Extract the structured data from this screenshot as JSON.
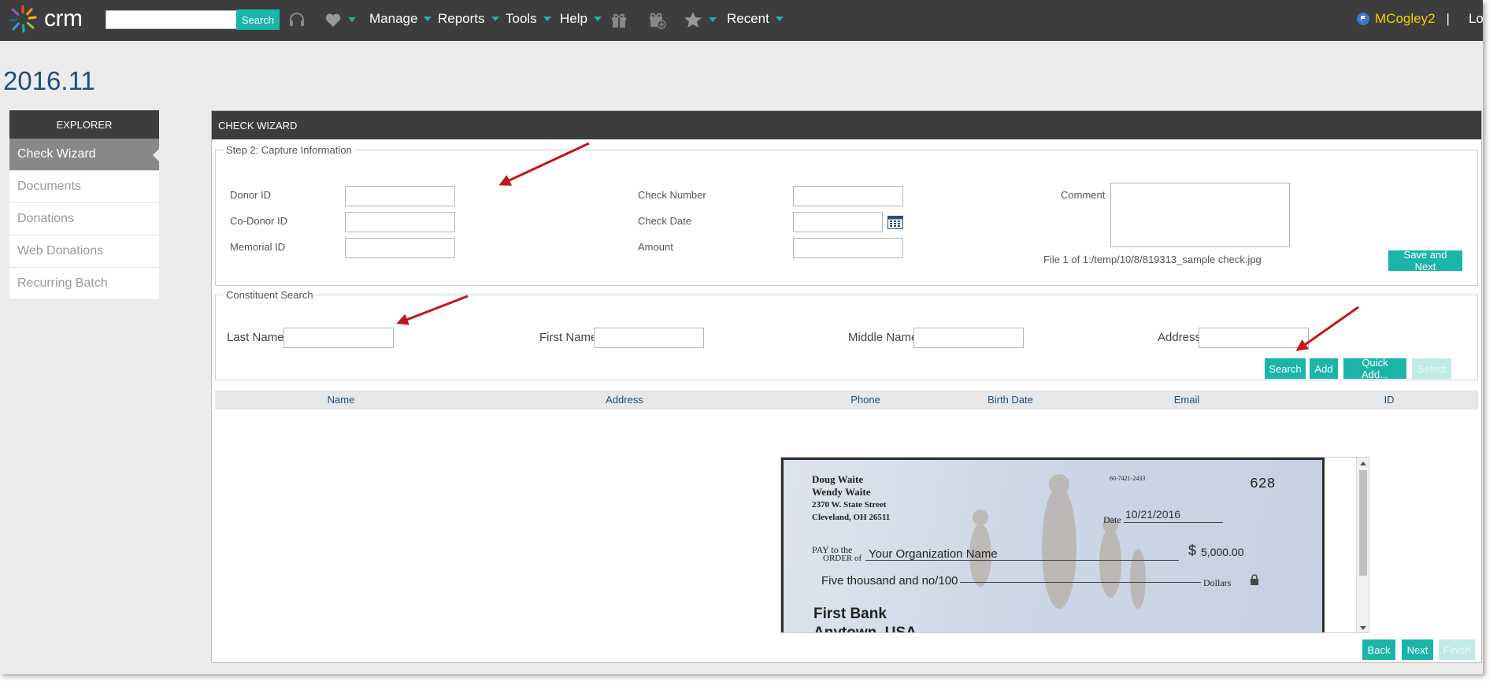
{
  "app": {
    "logo_text": "crm"
  },
  "topnav": {
    "search_placeholder": "",
    "search_button": "Search",
    "items": [
      "Manage",
      "Reports",
      "Tools",
      "Help",
      "Recent"
    ],
    "user_name": "MCogley2",
    "separator": "|",
    "logout_label": "Log"
  },
  "page": {
    "title": "2016.11"
  },
  "sidebar": {
    "header": "EXPLORER",
    "items": [
      {
        "label": "Check Wizard",
        "active": true
      },
      {
        "label": "Documents"
      },
      {
        "label": "Donations"
      },
      {
        "label": "Web Donations"
      },
      {
        "label": "Recurring Batch"
      }
    ]
  },
  "wizard": {
    "header": "CHECK WIZARD",
    "capture": {
      "legend": "Step 2: Capture Information",
      "donor_id_label": "Donor ID",
      "codonor_id_label": "Co-Donor ID",
      "memorial_id_label": "Memorial ID",
      "check_number_label": "Check Number",
      "check_date_label": "Check Date",
      "amount_label": "Amount",
      "comment_label": "Comment",
      "file_info": "File 1 of 1:/temp/10/8/819313_sample check.jpg",
      "save_next_button": "Save and Next"
    },
    "search": {
      "legend": "Constituent Search",
      "last_name_label": "Last Name",
      "first_name_label": "First Name",
      "middle_name_label": "Middle Name",
      "address_label": "Address",
      "buttons": {
        "search": "Search",
        "add": "Add",
        "quick_add": "Quick Add...",
        "select": "Select"
      }
    },
    "results": {
      "columns": [
        "Name",
        "Address",
        "Phone",
        "Birth Date",
        "Email",
        "ID"
      ]
    },
    "check_image": {
      "name1": "Doug Waite",
      "name2": "Wendy Waite",
      "address1": "2370 W. State Street",
      "address2": "Cleveland, OH 26511",
      "routing": "60-7421-2433",
      "check_number": "628",
      "date_label": "Date",
      "date_value": "10/21/2016",
      "pay_label_1": "PAY to the",
      "pay_label_2": "ORDER of",
      "payee": "Your Organization Name",
      "currency": "$",
      "amount": "5,000.00",
      "amount_words": "Five thousand and no/100",
      "dollars_label": "Dollars",
      "bank_name": "First Bank",
      "bank_city": "Anytown, USA"
    },
    "footer": {
      "back": "Back",
      "next": "Next",
      "finish": "Finish"
    }
  },
  "colors": {
    "accent": "#1ab5a8",
    "nav_bg": "#3d3d3d",
    "title": "#1e4d7b",
    "user": "#f5d000",
    "arrow": "#c0171d"
  }
}
